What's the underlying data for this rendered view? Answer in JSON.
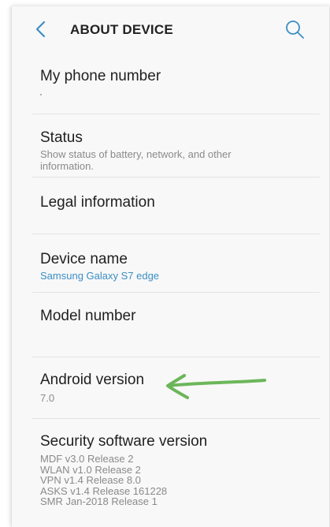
{
  "header": {
    "title": "ABOUT DEVICE",
    "back_icon": "chevron-left-icon",
    "search_icon": "search-icon",
    "accent": "#3b8ec4"
  },
  "items": [
    {
      "title": "My phone number",
      "subtitle": ""
    },
    {
      "title": "Status",
      "subtitle": "Show status of battery, network, and other information."
    },
    {
      "title": "Legal information",
      "subtitle": ""
    },
    {
      "title": "Device name",
      "subtitle": "Samsung Galaxy S7 edge"
    },
    {
      "title": "Model number",
      "subtitle": ""
    },
    {
      "title": "Android version",
      "subtitle": "7.0"
    },
    {
      "title": "Security software version",
      "lines": [
        "MDF v3.0 Release 2",
        "WLAN v1.0 Release 2",
        "VPN v1.4 Release 8.0",
        "ASKS v1.4 Release 161228",
        "SMR Jan-2018 Release 1"
      ]
    }
  ],
  "annotation": {
    "arrow_color": "#6cb65a"
  }
}
